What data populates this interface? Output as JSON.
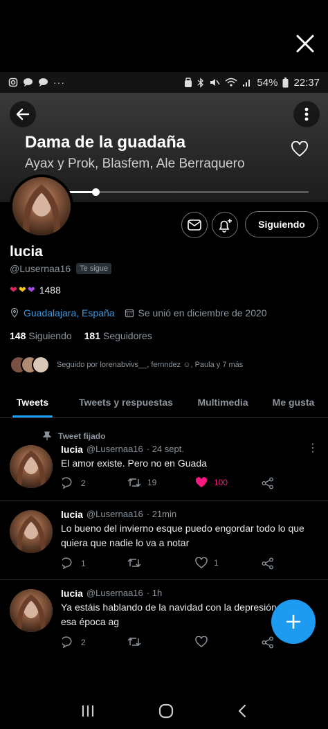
{
  "status_bar": {
    "battery": "54%",
    "time": "22:37"
  },
  "now_playing": {
    "title": "Dama de la guadaña",
    "artists": "Ayax y Prok, Blasfem, Ale Berraquero",
    "progress": 0.13
  },
  "profile": {
    "follow_label": "Siguiendo",
    "name": "lucia",
    "handle": "@Lusernaa16",
    "follows_you_badge": "Te sigue",
    "bio_text": "1488",
    "location": "Guadalajara, España",
    "joined": "Se unió en diciembre de 2020",
    "following_count": "148",
    "following_label": "Siguiendo",
    "followers_count": "181",
    "followers_label": "Seguidores",
    "followed_by": "Seguido por lorenabvivs__, fernndez ☺, Paula y 7 más"
  },
  "tabs": [
    "Tweets",
    "Tweets y respuestas",
    "Multimedia",
    "Me gusta"
  ],
  "pinned_label": "Tweet fijado",
  "tweets": [
    {
      "name": "lucia",
      "handle": "@Lusernaa16",
      "time": "· 24 sept.",
      "text": "El amor existe. Pero no en Guada",
      "replies": "2",
      "retweets": "19",
      "likes": "100"
    },
    {
      "name": "lucia",
      "handle": "@Lusernaa16",
      "time": "· 21min",
      "text": "Lo bueno del invierno esque puedo engordar todo lo que quiera que nadie lo va a notar",
      "replies": "1",
      "retweets": "",
      "likes": "1"
    },
    {
      "name": "lucia",
      "handle": "@Lusernaa16",
      "time": "· 1h",
      "text": "Ya estáis hablando de la navidad con la depresión de la esa época ag",
      "replies": "2",
      "retweets": "",
      "likes": ""
    }
  ],
  "colors": {
    "accent": "#1d9bf0",
    "like": "#f91880",
    "link": "#3e97de"
  },
  "icons": [
    "close-icon",
    "back-arrow-icon",
    "more-vertical-icon",
    "heart-outline-icon",
    "mail-icon",
    "bell-plus-icon",
    "location-icon",
    "calendar-icon",
    "pin-icon",
    "reply-icon",
    "retweet-icon",
    "like-icon",
    "share-icon",
    "compose-plus-icon"
  ]
}
